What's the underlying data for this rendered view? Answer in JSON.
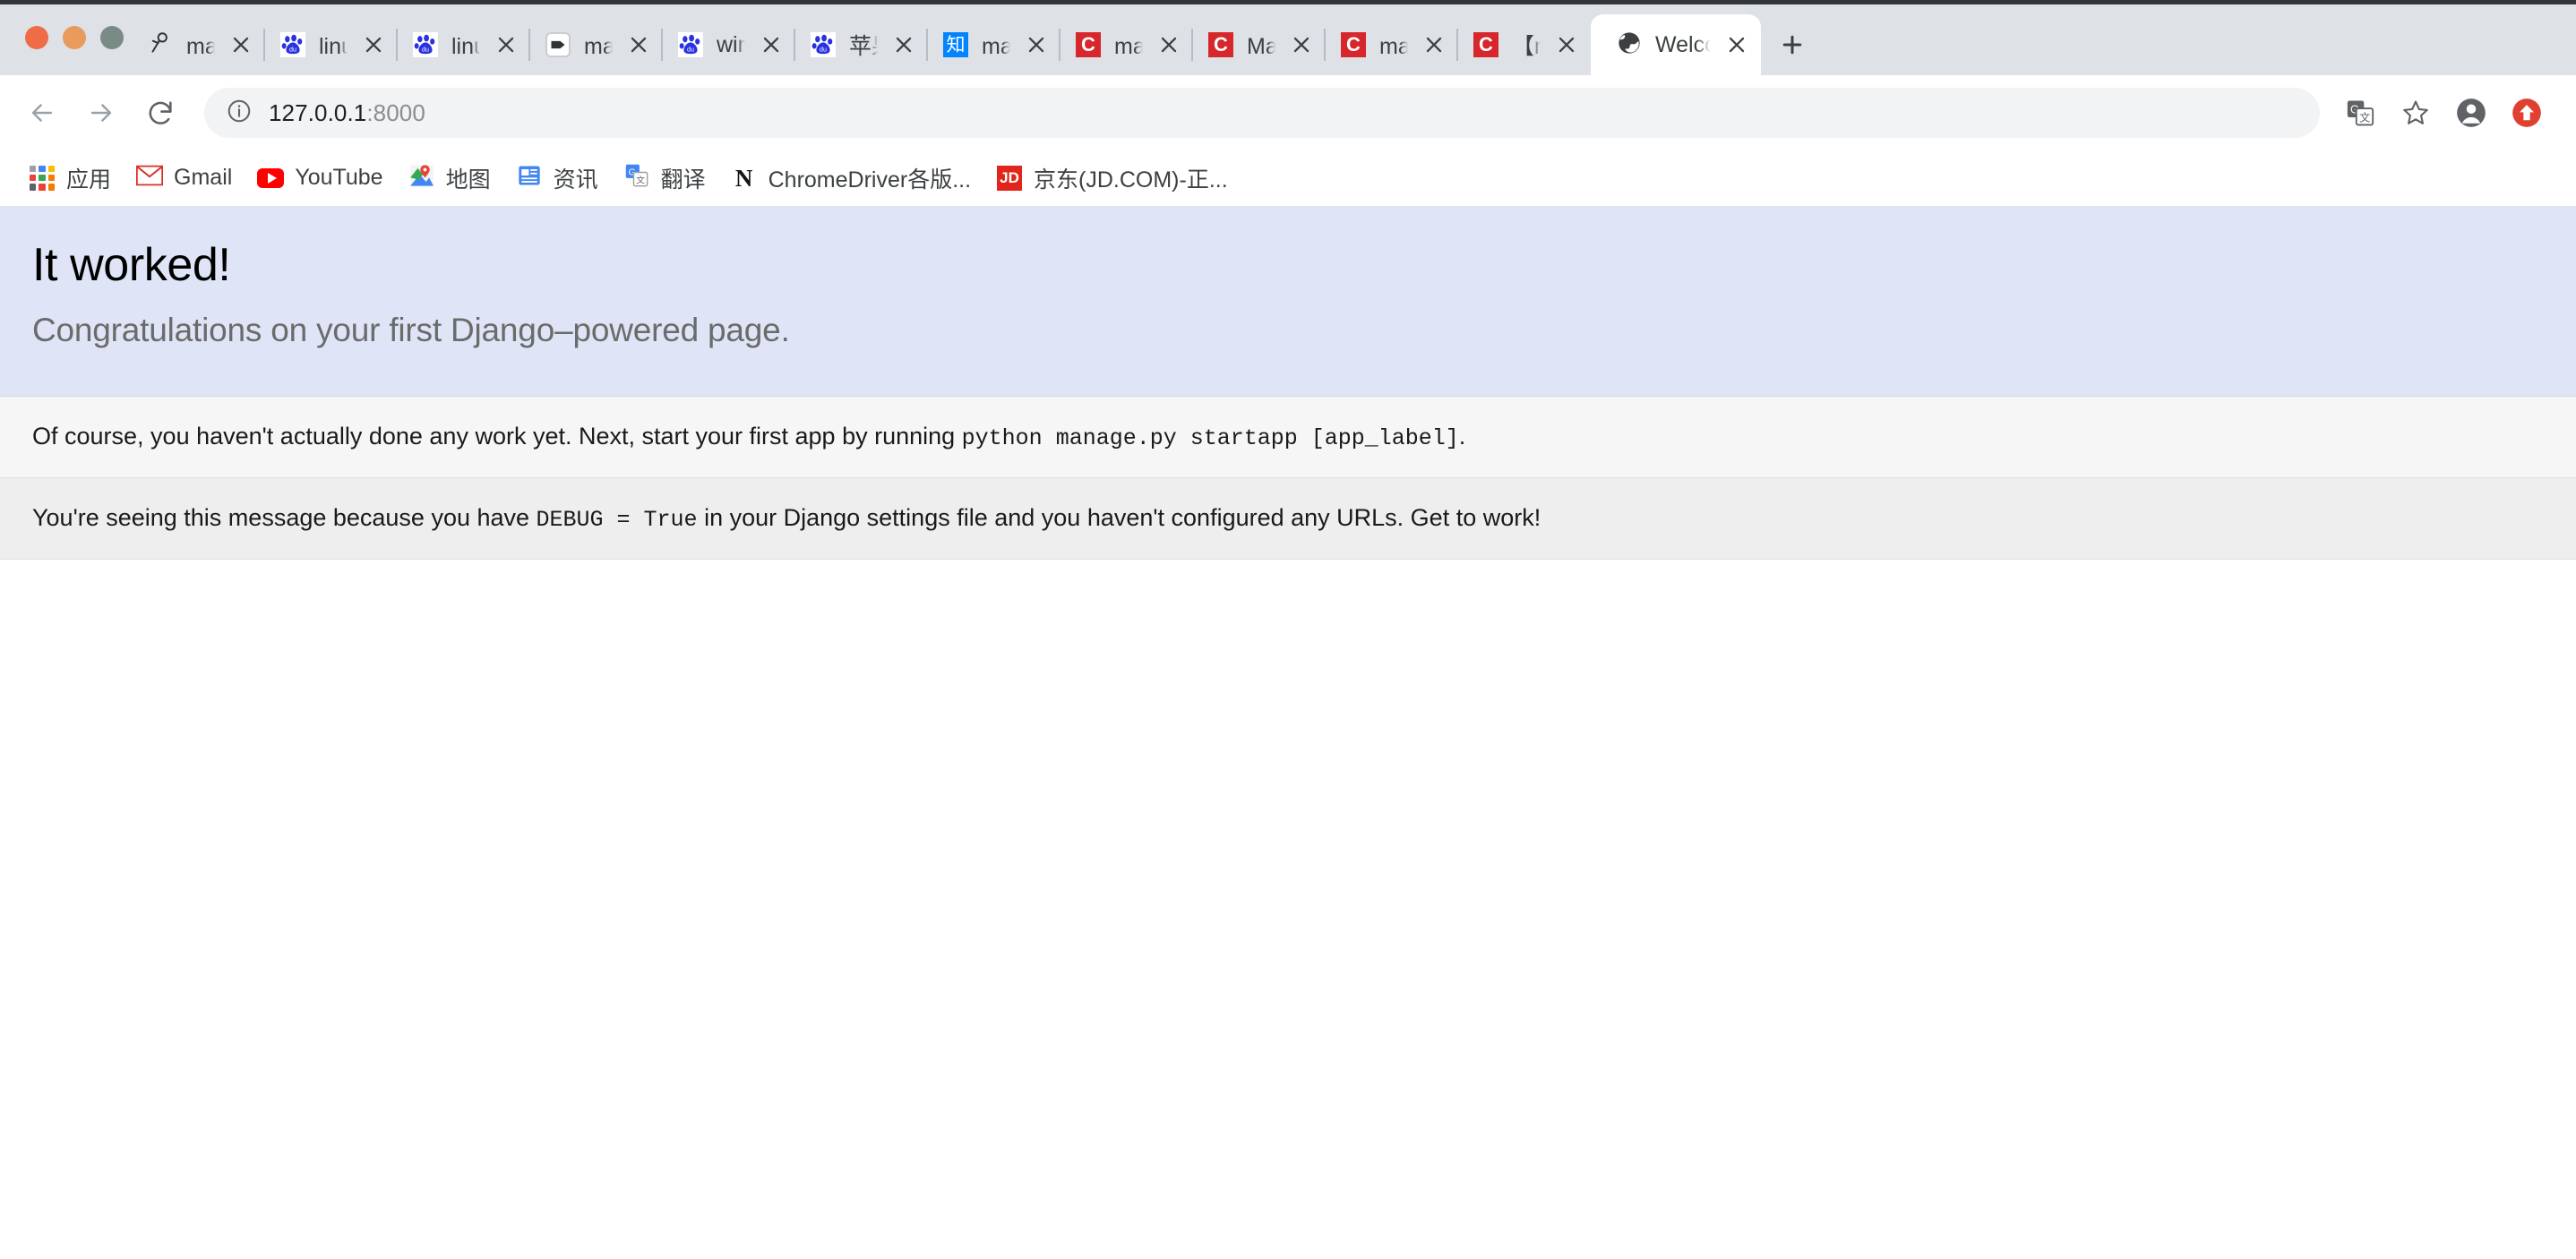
{
  "window": {
    "traffic_lights": [
      "close",
      "minimize",
      "maximize"
    ]
  },
  "tabs": [
    {
      "title": "mac下载",
      "favicon": "sogou-icon",
      "close_label": "✕"
    },
    {
      "title": "linux 改",
      "favicon": "baidu-icon",
      "close_label": "✕"
    },
    {
      "title": "linux怎么",
      "favicon": "baidu-icon",
      "close_label": "✕"
    },
    {
      "title": "mac 的",
      "favicon": "jianshu-icon",
      "close_label": "✕"
    },
    {
      "title": "window",
      "favicon": "baidu-icon",
      "close_label": "✕"
    },
    {
      "title": "苹果电脑",
      "favicon": "baidu-icon",
      "close_label": "✕"
    },
    {
      "title": "mac安装",
      "favicon": "zhihu-icon",
      "favicon_text": "知",
      "close_label": "✕"
    },
    {
      "title": "mac安装",
      "favicon": "csdn-icon",
      "favicon_text": "C",
      "close_label": "✕"
    },
    {
      "title": "Mac上配",
      "favicon": "csdn-icon",
      "favicon_text": "C",
      "close_label": "✕"
    },
    {
      "title": "mac 下载",
      "favicon": "csdn-icon",
      "favicon_text": "C",
      "close_label": "✕"
    },
    {
      "title": "【mac】",
      "favicon": "csdn-icon",
      "favicon_text": "C",
      "close_label": "✕"
    },
    {
      "title": "Welcome",
      "favicon": "globe-icon",
      "close_label": "✕",
      "active": true
    }
  ],
  "newtab": {
    "label": "+"
  },
  "toolbar": {
    "back_label": "←",
    "forward_label": "→",
    "reload_label": "⟳",
    "site_info_label": "ⓘ",
    "url_host": "127.0.0.1",
    "url_port": ":8000",
    "url_full": "127.0.0.1:8000",
    "translate_label": "translate",
    "bookmark_star_label": "☆",
    "profile_label": "profile",
    "update_label": "update"
  },
  "bookmarks": [
    {
      "label": "应用",
      "icon": "apps-grid-icon"
    },
    {
      "label": "Gmail",
      "icon": "gmail-icon"
    },
    {
      "label": "YouTube",
      "icon": "youtube-icon"
    },
    {
      "label": "地图",
      "icon": "maps-icon"
    },
    {
      "label": "资讯",
      "icon": "news-icon"
    },
    {
      "label": "翻译",
      "icon": "translate-icon"
    },
    {
      "label": "ChromeDriver各版...",
      "icon": "n-icon",
      "icon_text": "N"
    },
    {
      "label": "京东(JD.COM)-正...",
      "icon": "jd-icon",
      "icon_text": "JD"
    }
  ],
  "page": {
    "heading": "It worked!",
    "subheading": "Congratulations on your first Django–powered page.",
    "paragraph1_pre": "Of course, you haven't actually done any work yet. Next, start your first app by running ",
    "paragraph1_code": "python manage.py startapp [app_label]",
    "paragraph1_post": ".",
    "paragraph2_pre": "You're seeing this message because you have ",
    "paragraph2_code1": "DEBUG = True",
    "paragraph2_post": " in your Django settings file and you haven't configured any URLs. Get to work!"
  },
  "colors": {
    "hero_bg": "#dfe5f6",
    "band_a_bg": "#f6f6f6",
    "band_b_bg": "#eeeeee",
    "tabstrip_bg": "#dee1e6",
    "omnibox_bg": "#f1f3f4",
    "update_red": "#e04030"
  }
}
